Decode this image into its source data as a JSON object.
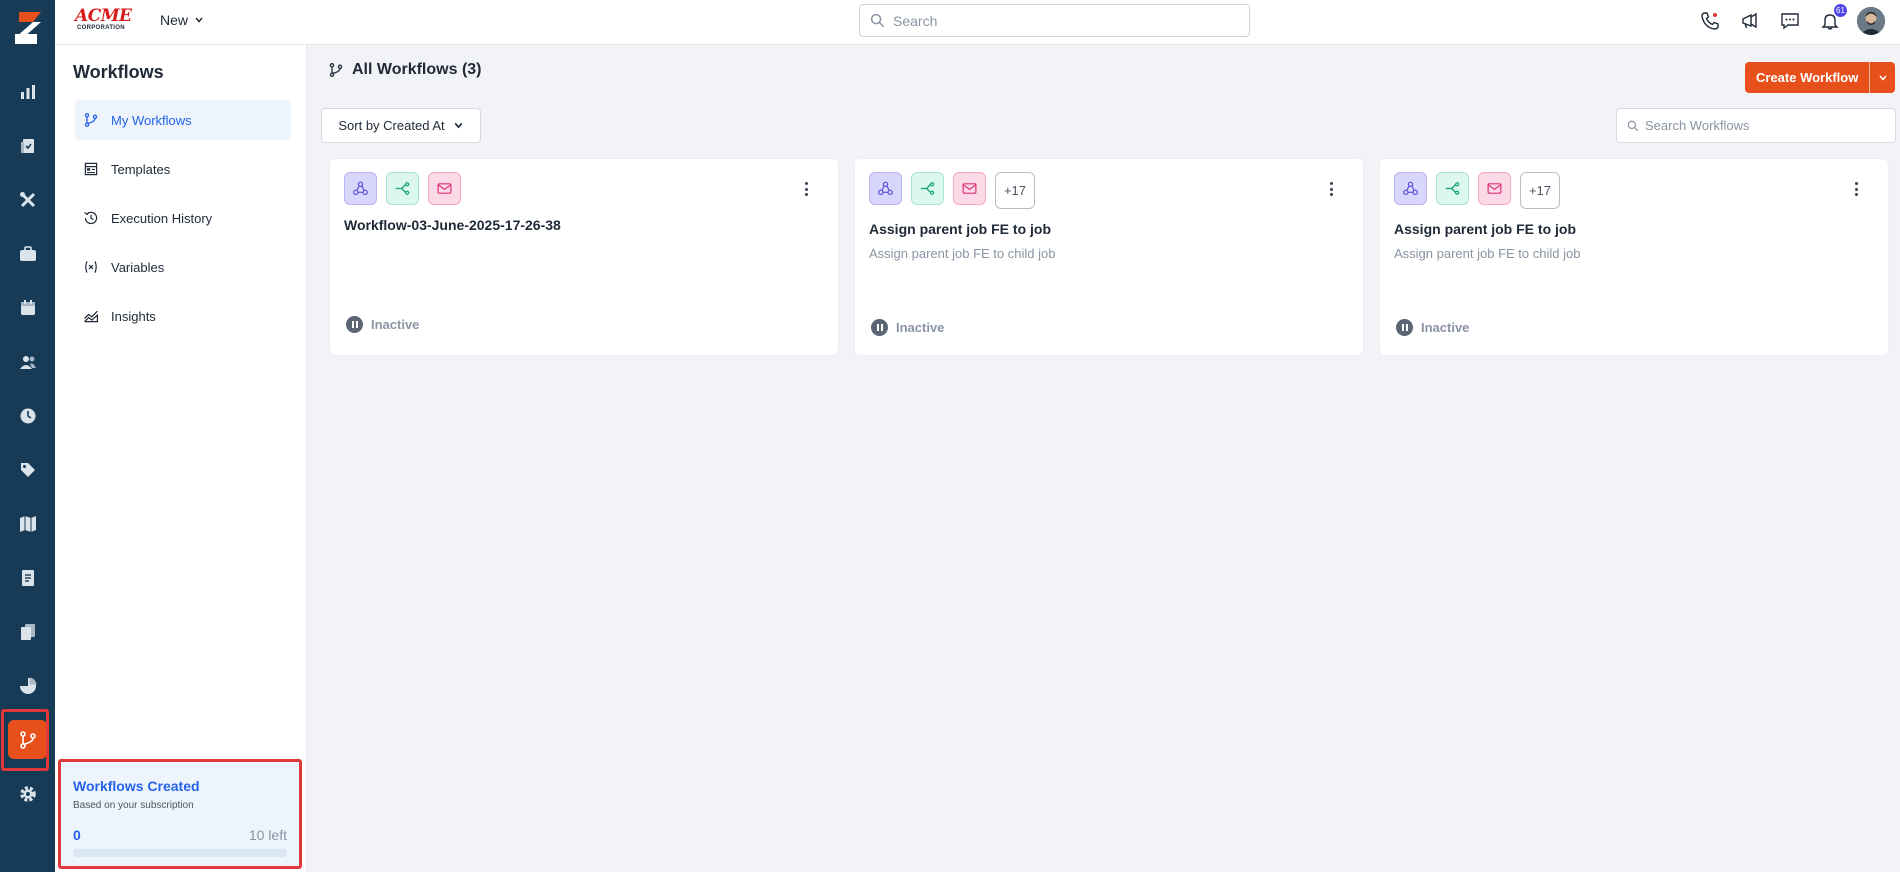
{
  "colors": {
    "rail": "#173b57",
    "accent": "#e8501b",
    "primary": "#2563eb",
    "highlight": "#e0383b"
  },
  "header": {
    "brand_name": "ACME",
    "brand_sub": "CORPORATION",
    "new_label": "New",
    "search_placeholder": "Search",
    "notification_count": "61"
  },
  "rail": {
    "items": [
      "dashboard-icon",
      "jobs-icon",
      "tools-icon",
      "briefcase-icon",
      "calendar-icon",
      "users-icon",
      "clock-icon",
      "tag-icon",
      "map-icon",
      "receipt-icon",
      "documents-icon",
      "reports-icon",
      "workflow-icon",
      "settings-icon"
    ],
    "active": "workflow-icon"
  },
  "subnav": {
    "title": "Workflows",
    "items": [
      {
        "label": "My Workflows",
        "icon": "workflow-icon",
        "active": true
      },
      {
        "label": "Templates",
        "icon": "template-icon",
        "active": false
      },
      {
        "label": "Execution History",
        "icon": "history-icon",
        "active": false
      },
      {
        "label": "Variables",
        "icon": "variables-icon",
        "active": false
      },
      {
        "label": "Insights",
        "icon": "insights-icon",
        "active": false
      }
    ],
    "quota": {
      "title": "Workflows Created",
      "subtitle": "Based on your subscription",
      "used": "0",
      "left": "10 left",
      "fraction": 0
    }
  },
  "main": {
    "title": "All Workflows (3)",
    "create_label": "Create Workflow",
    "sort_label": "Sort by Created At",
    "search_placeholder": "Search Workflows",
    "cards": [
      {
        "title": "Workflow-03-June-2025-17-26-38",
        "description": "",
        "status": "Inactive",
        "more": ""
      },
      {
        "title": "Assign parent job FE to job",
        "description": "Assign parent job FE to child job",
        "status": "Inactive",
        "more": "+17"
      },
      {
        "title": "Assign parent job FE to job",
        "description": "Assign parent job FE to child job",
        "status": "Inactive",
        "more": "+17"
      }
    ]
  }
}
